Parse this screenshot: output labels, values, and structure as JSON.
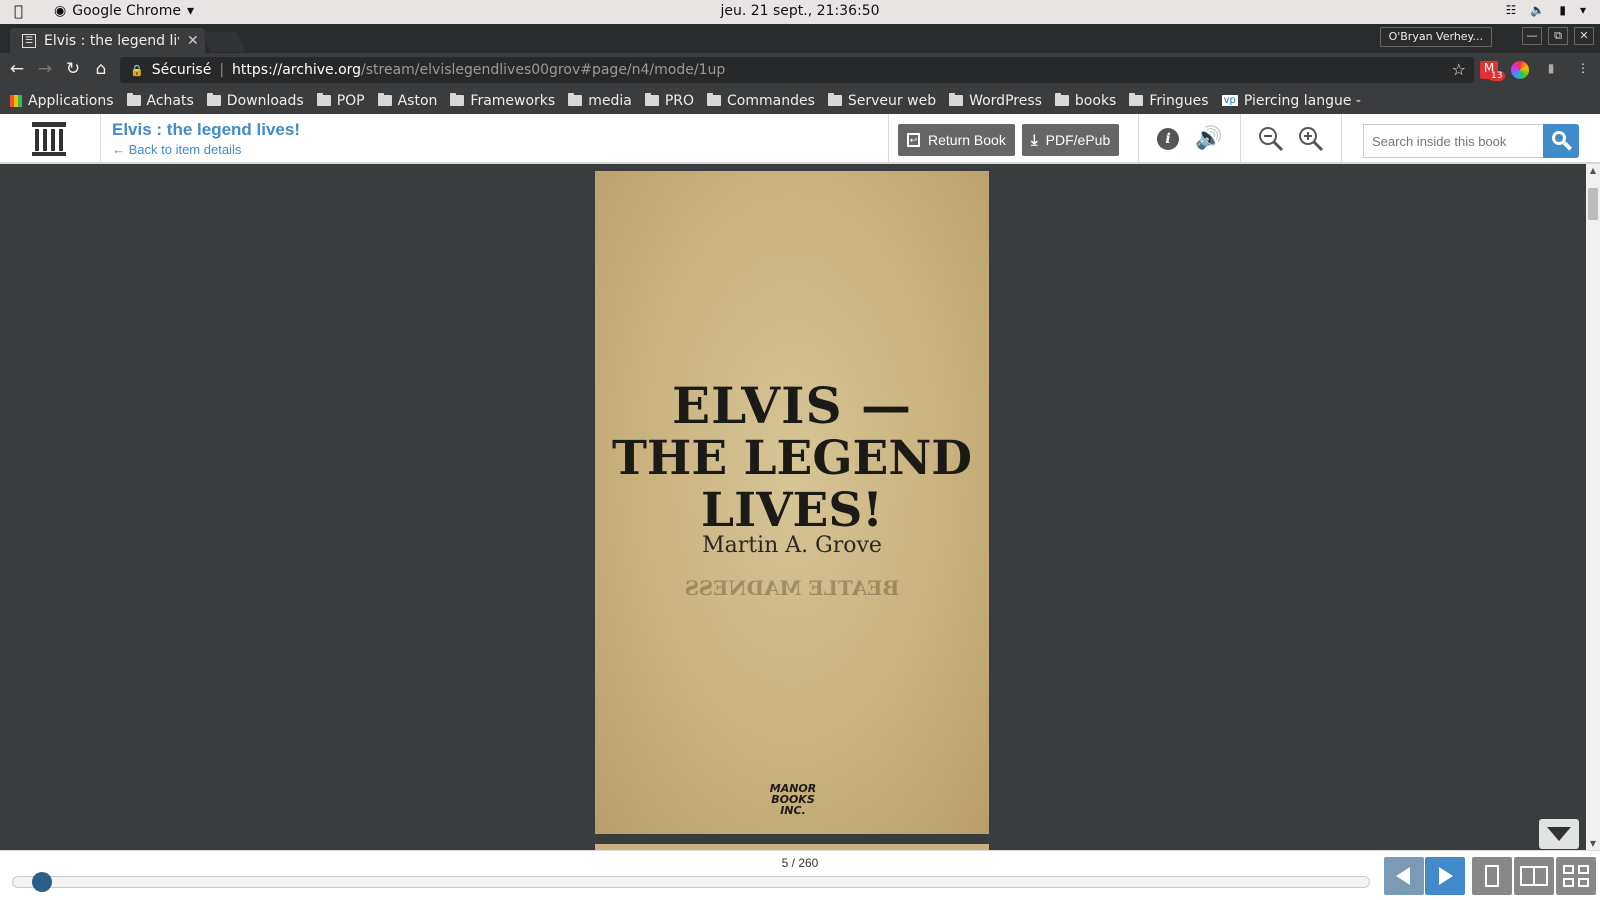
{
  "os": {
    "app_name": "Google Chrome",
    "clock": "jeu. 21 sept., 21:36:50"
  },
  "browser": {
    "tab_title": "Elvis : the legend lives!",
    "profile": "O'Bryan Verhey...",
    "secure_label": "Sécurisé",
    "url_host": "https://archive.org",
    "url_path": "/stream/elvislegendlives00grov#page/n4/mode/1up",
    "gmail_badge": "13"
  },
  "bookmarks": [
    {
      "label": "Applications",
      "kind": "apps"
    },
    {
      "label": "Achats",
      "kind": "folder"
    },
    {
      "label": "Downloads",
      "kind": "folder"
    },
    {
      "label": "POP",
      "kind": "folder"
    },
    {
      "label": "Aston",
      "kind": "folder"
    },
    {
      "label": "Frameworks",
      "kind": "folder"
    },
    {
      "label": "media",
      "kind": "folder"
    },
    {
      "label": "PRO",
      "kind": "folder"
    },
    {
      "label": "Commandes",
      "kind": "folder"
    },
    {
      "label": "Serveur web",
      "kind": "folder"
    },
    {
      "label": "WordPress",
      "kind": "folder"
    },
    {
      "label": "books",
      "kind": "folder"
    },
    {
      "label": "Fringues",
      "kind": "folder"
    },
    {
      "label": "Piercing langue -",
      "kind": "site"
    }
  ],
  "reader": {
    "title": "Elvis : the legend lives!",
    "back_link": "← Back to item details",
    "return_label": "Return Book",
    "download_label": "PDF/ePub",
    "search_placeholder": "Search inside this book",
    "page_indicator": "5 / 260",
    "progress_fraction": 0.015
  },
  "book_page": {
    "line1": "ELVIS —",
    "line2": "THE LEGEND",
    "line3": "LIVES!",
    "author": "Martin A. Grove",
    "bleed_through": "BEATLE MADNESS",
    "publisher_logo_text": "MANOR BOOKS INC."
  },
  "colors": {
    "accent": "#428bca",
    "header_button": "#666666",
    "viewer_bg": "#3a3d3d"
  }
}
